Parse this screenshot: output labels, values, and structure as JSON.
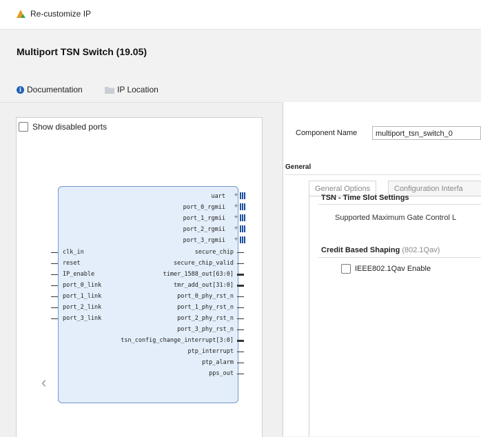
{
  "window": {
    "title": "Re-customize IP",
    "logo_icon": "vivado-logo-icon"
  },
  "header": {
    "ip_title": "Multiport TSN Switch (19.05)",
    "documentation_label": "Documentation",
    "ip_location_label": "IP Location"
  },
  "left_panel": {
    "show_disabled_ports_label": "Show disabled ports",
    "show_disabled_ports_checked": false,
    "right_ports": [
      "uart",
      "port_0_rgmii",
      "port_1_rgmii",
      "port_2_rgmii",
      "port_3_rgmii",
      "secure_chip",
      "secure_chip_valid",
      "timer_1588_out[63:0]",
      "tmr_add_out[31:0]",
      "port_0_phy_rst_n",
      "port_1_phy_rst_n",
      "port_2_phy_rst_n",
      "port_3_phy_rst_n",
      "tsn_config_change_interrupt[3:0]",
      "ptp_interrupt",
      "ptp_alarm",
      "pps_out"
    ],
    "left_ports": [
      "clk_in",
      "reset",
      "IP_enable",
      "port_0_link",
      "port_1_link",
      "port_2_link",
      "port_3_link"
    ],
    "prev_arrow": "‹"
  },
  "right_panel": {
    "component_name_label": "Component Name",
    "component_name_value": "multiport_tsn_switch_0",
    "general_label": "General",
    "tabs": [
      "General Options",
      "Configuration Interfa"
    ],
    "tsn_section_title": "TSN - Time Slot Settings",
    "tsn_text": "Supported Maximum Gate Control L",
    "cbs_section_title": "Credit Based Shaping",
    "cbs_section_suffix": "(802.1Qav)",
    "qav_enable_label": "IEEE802.1Qav Enable",
    "qav_enable_checked": false
  }
}
